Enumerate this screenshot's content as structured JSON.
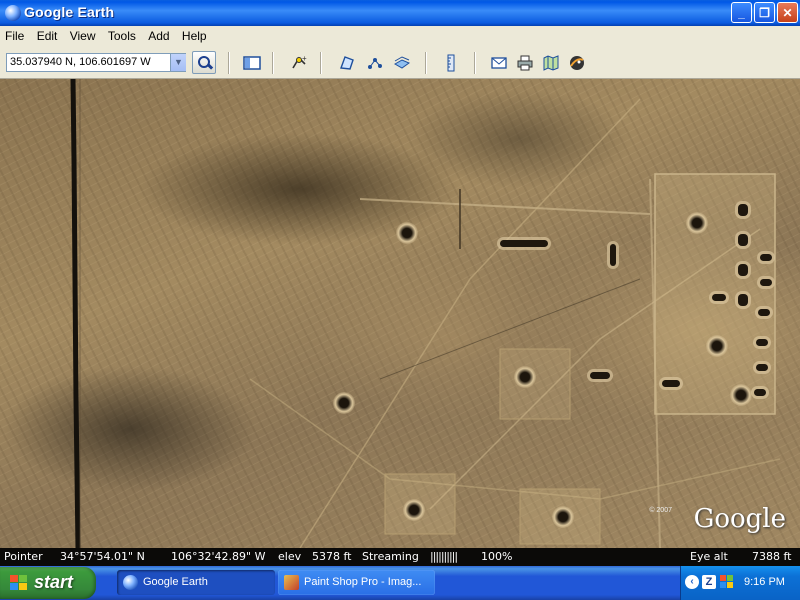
{
  "window": {
    "title": "Google Earth",
    "controls": {
      "minimize": "_",
      "maximize": "❐",
      "close": "✕"
    }
  },
  "menu": [
    "File",
    "Edit",
    "View",
    "Tools",
    "Add",
    "Help"
  ],
  "toolbar": {
    "search_value": "35.037940 N, 106.601697 W",
    "icons": [
      "sidebar-icon",
      "placemark-icon",
      "polygon-icon",
      "path-icon",
      "image-overlay-icon",
      "ruler-icon",
      "email-icon",
      "print-icon",
      "maps-icon",
      "sky-icon"
    ]
  },
  "map": {
    "logo": "Google",
    "copyright": "© 2007"
  },
  "status": {
    "pointer_label": "Pointer",
    "lat": "34°57'54.01\" N",
    "lon": "106°32'42.89\" W",
    "elev_label": "elev",
    "elev": "5378 ft",
    "streaming_label": "Streaming",
    "streaming_bar": "||||||||||",
    "streaming_pct": "100%",
    "eye_label": "Eye alt",
    "eye_alt": "7388 ft"
  },
  "taskbar": {
    "start": "start",
    "items": [
      {
        "label": "Google Earth",
        "active": true
      },
      {
        "label": "Paint Shop Pro - Imag...",
        "active": false
      }
    ],
    "clock": "9:16 PM"
  },
  "colors": {
    "xp_blue": "#0058e6",
    "start_green": "#3c9a3c",
    "terrain": "#a38a60"
  }
}
